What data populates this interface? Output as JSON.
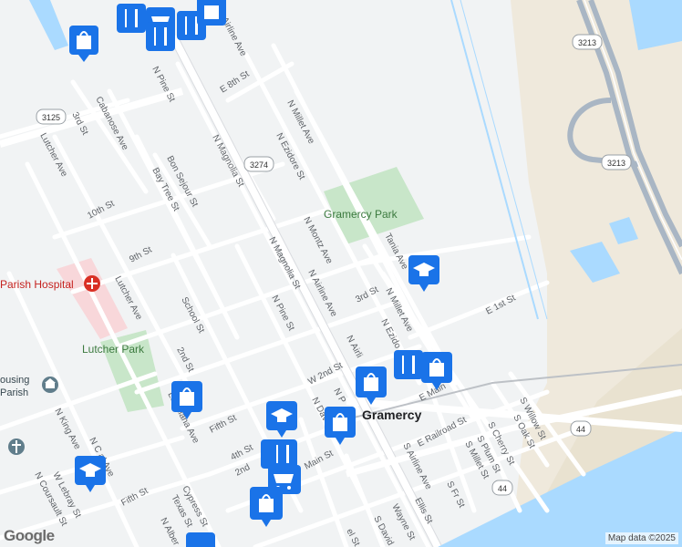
{
  "attribution": "Map data ©2025",
  "logo": "Google",
  "shields": {
    "r3213a": "3213",
    "r3213b": "3213",
    "r3125": "3125",
    "r3274": "3274",
    "r44a": "44",
    "r44b": "44"
  },
  "parks": {
    "gramercy_park": "Gramercy Park",
    "lutcher_park": "Lutcher Park"
  },
  "places": {
    "gramercy": "Gramercy",
    "hospital": "Parish Hospital",
    "housing_1": "ousing",
    "housing_2": "Parish"
  },
  "streets": {
    "n_airline_top": "N Airline Ave",
    "e_8th": "E 8th St",
    "n_pine_top": "N Pine St",
    "n_millet_top": "N Millet Ave",
    "n_ezidore_top": "N Ezidore St",
    "cabanose": "Cabanose Ave",
    "third_st": "3rd St",
    "lutcher_ave_top": "Lutcher Ave",
    "n_magnolia_top": "N Magnolia St",
    "bon_sejour": "Bon Sejour St",
    "bay_tree": "Bay Tree St",
    "tenth": "10th St",
    "ninth": "9th St",
    "n_montz": "N Montz Ave",
    "tania": "Tania Ave",
    "n_magnolia_mid": "N Magnolia St",
    "n_airline_mid": "N Airline Ave",
    "n_airline_low": "N Airli",
    "lutcher_ave_mid": "Lutcher Ave",
    "school": "School St",
    "n_pine_mid": "N Pine St",
    "third_e": "3rd St",
    "n_millet_mid": "N Millet Ave",
    "n_ezidore_mid": "N Ezido",
    "e_1st": "E 1st St",
    "second": "2nd St",
    "w_2nd": "W 2nd St",
    "n_dav": "N Dav",
    "n_p": "N P",
    "e_main": "E Main",
    "louisiana": "Louisiana Ave",
    "fifth_st": "Fifth St",
    "fourth": "4th St",
    "second_b": "2nd",
    "main_st": "Main St",
    "n_king": "N King Ave",
    "n_c_ave": "N C    al Ave",
    "w_lebray": "W Lebray St",
    "n_coursault": "N Coursault St",
    "fifth_st_b": "Fifth St",
    "cypress": "Cypress St",
    "texas": "Texas St",
    "n_alber": "N Alber",
    "s_airline": "S Airline Ave",
    "e_railroad": "E Railroad St",
    "s_cherry": "S Cherry St",
    "s_oak": "S Oak St",
    "s_willow": "S Willow St",
    "s_plum": "S Plum St",
    "s_millet": "S Millet St",
    "s_fr": "S Fr St",
    "ellis": "Ellis St",
    "wayne": "Wayne St",
    "s_david": "S David",
    "el_st": "el St",
    "c_st": "C"
  },
  "colors": {
    "background": "#f1f3f4",
    "road": "#ffffff",
    "road_edge": "#dadce0",
    "highway": "#a9b6c4",
    "water": "#aadaff",
    "park": "#c8e6c9",
    "hospital_area": "#f8d7da",
    "industrial": "#efe9dc",
    "poi_blue": "#1a73e8",
    "poi_dark": "#455a64"
  }
}
